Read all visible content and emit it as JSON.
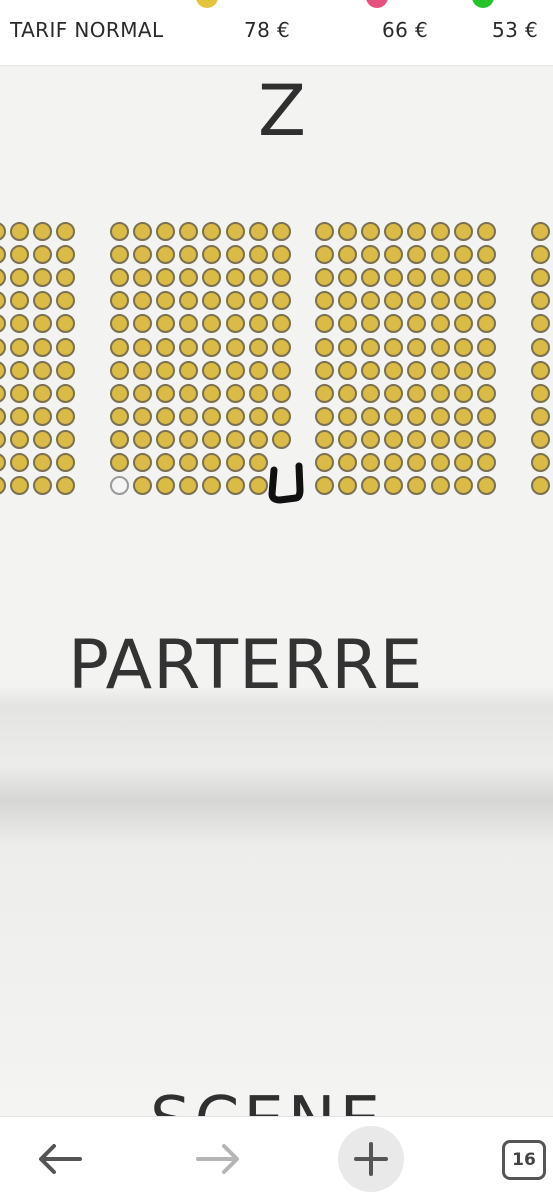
{
  "price_bar": {
    "label": "TARIF NORMAL",
    "tiers": [
      {
        "price": "78 €",
        "color": "#e3c43c"
      },
      {
        "price": "66 €",
        "color": "#e6507c"
      },
      {
        "price": "53 €",
        "color": "#25c32a"
      }
    ]
  },
  "seat_map": {
    "row_letter": "Z",
    "section_label": "PARTERRE",
    "stage_label": "SCENE",
    "seat_color": "#d9bb46",
    "free_seat_color": "#f4f4f4",
    "annotation_color": "#111111"
  },
  "bottom_nav": {
    "tab_count": "16",
    "icons": [
      "arrow-left-icon",
      "arrow-right-icon",
      "plus-icon",
      "tabs-icon"
    ]
  }
}
